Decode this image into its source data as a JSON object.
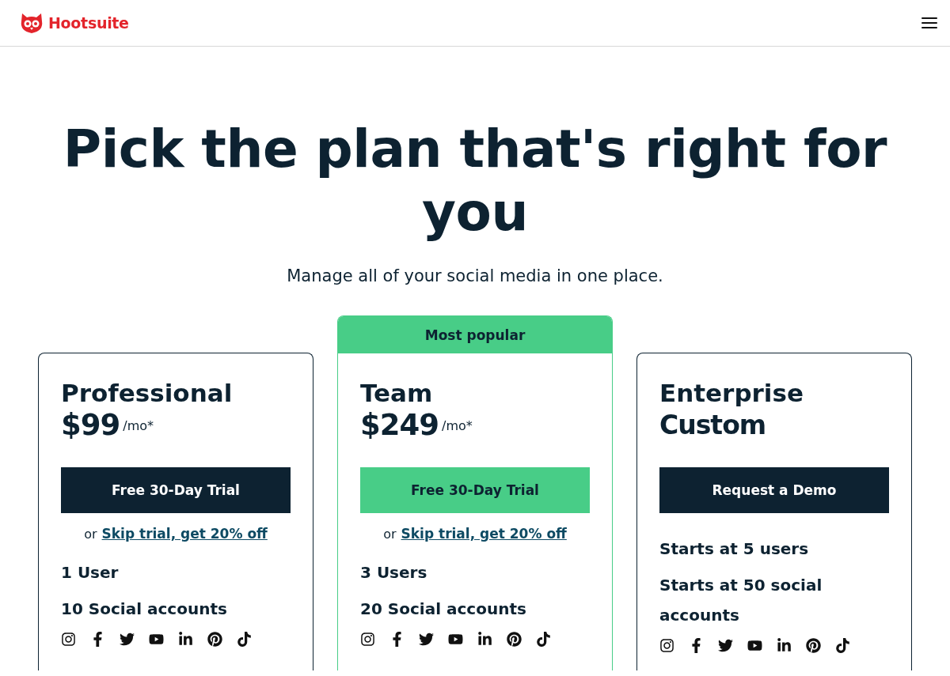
{
  "header": {
    "brand": "Hootsuite"
  },
  "hero": {
    "title": "Pick the plan that's right for you",
    "subtitle": "Manage all of your social media in one place."
  },
  "plans": [
    {
      "name": "Professional",
      "price": "$99",
      "price_suffix": "/mo*",
      "featured": false,
      "button": "Free 30-Day Trial",
      "skip_prefix": "or",
      "skip_link": "Skip trial, get 20% off",
      "features": [
        "1 User",
        "10 Social accounts"
      ]
    },
    {
      "name": "Team",
      "badge": "Most popular",
      "price": "$249",
      "price_suffix": "/mo*",
      "featured": true,
      "button": "Free 30-Day Trial",
      "skip_prefix": "or",
      "skip_link": "Skip trial, get 20% off",
      "features": [
        "3 Users",
        "20 Social accounts"
      ]
    },
    {
      "name": "Enterprise",
      "price": "Custom",
      "featured": false,
      "button": "Request a Demo",
      "features": [
        "Starts at 5 users",
        "Starts at 50 social accounts"
      ]
    }
  ]
}
